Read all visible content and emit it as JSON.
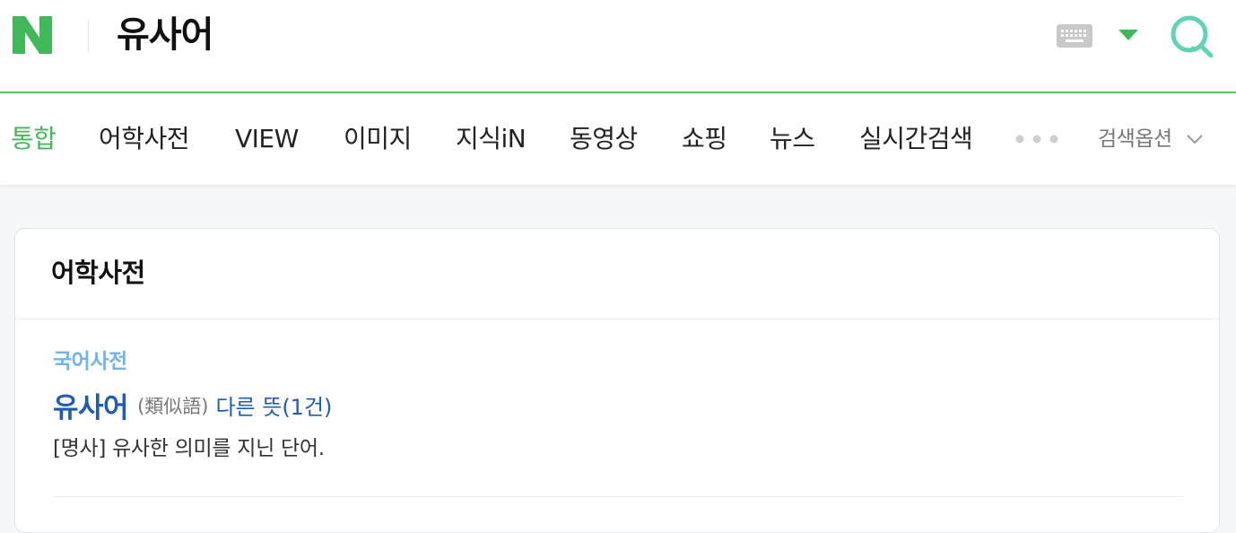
{
  "header": {
    "query": "유사어",
    "brand_color": "#41b95b"
  },
  "nav": {
    "tabs": [
      {
        "label": "통합",
        "active": true
      },
      {
        "label": "어학사전",
        "active": false
      },
      {
        "label": "VIEW",
        "active": false
      },
      {
        "label": "이미지",
        "active": false
      },
      {
        "label": "지식iN",
        "active": false
      },
      {
        "label": "동영상",
        "active": false
      },
      {
        "label": "쇼핑",
        "active": false
      },
      {
        "label": "뉴스",
        "active": false
      },
      {
        "label": "실시간검색",
        "active": false
      }
    ],
    "options_label": "검색옵션"
  },
  "card": {
    "title": "어학사전",
    "dictionary": "국어사전",
    "headword": "유사어",
    "hanja": "(類似語)",
    "other_meanings": "다른 뜻(1건)",
    "definition": "[명사] 유사한 의미를 지닌 단어."
  },
  "icons": [
    "naver-logo-icon",
    "keyboard-icon",
    "dropdown-icon",
    "search-icon",
    "more-dots-icon",
    "chevron-down-icon"
  ]
}
